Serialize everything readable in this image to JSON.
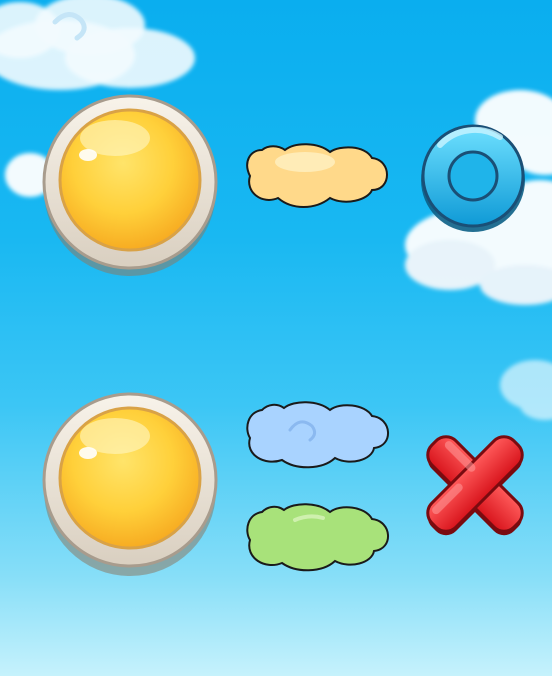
{
  "scene": {
    "background_top": "#0aaeef",
    "background_bottom": "#c6f2fc"
  },
  "rows": [
    {
      "button_icon": "golden-round-button-icon",
      "clouds": [
        {
          "icon": "yellow-cloud-icon",
          "color": "#ffd98a"
        }
      ],
      "result_icon": "blue-ring-icon",
      "result_color": "#1fb6ea"
    },
    {
      "button_icon": "golden-round-button-icon",
      "clouds": [
        {
          "icon": "blue-cloud-icon",
          "color": "#a9d3ff"
        },
        {
          "icon": "green-cloud-icon",
          "color": "#a8e27a"
        }
      ],
      "result_icon": "red-cross-icon",
      "result_color": "#e8202a"
    }
  ]
}
